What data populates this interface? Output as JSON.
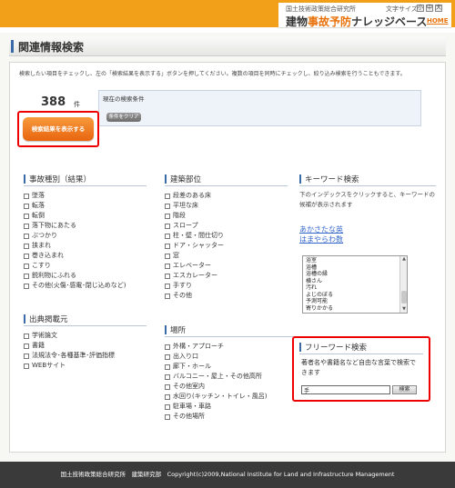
{
  "header": {
    "org_small": "国土技術政策総合研究所",
    "font_size_label": "文字サイズ",
    "font_buttons": [
      "小",
      "中",
      "大"
    ],
    "title_pre": "建物",
    "title_accent": "事故予防",
    "title_post": "ナレッジベース",
    "home_label": "HOME"
  },
  "page_title": "関連情報検索",
  "instructions": "検索したい項目をチェックし、左の「検索結果を表示する」ボタンを押してください。複数の項目を同時にチェックし、絞り込み検索を行うこともできます。",
  "result": {
    "count": "388",
    "unit": "件",
    "button_label": "検索結果を表示する"
  },
  "conditions": {
    "label": "現在の検索条件",
    "clear_label": "条件をクリア"
  },
  "accident_types": {
    "title": "事故種別（結果）",
    "items": [
      "墜落",
      "転落",
      "転倒",
      "落下物にあたる",
      "ぶつかり",
      "挟まれ",
      "巻き込まれ",
      "こすり",
      "鋭利物にふれる",
      "その他(火傷･感電･閉じ込めなど)"
    ]
  },
  "building_parts": {
    "title": "建築部位",
    "items": [
      "段差のある床",
      "平坦な床",
      "階段",
      "スロープ",
      "柱・壁・間仕切り",
      "ドア・シャッター",
      "窓",
      "エレベーター",
      "エスカレーター",
      "手すり",
      "その他"
    ]
  },
  "keyword_search": {
    "title": "キーワード検索",
    "text": "下のインデックスをクリックすると、キーワードの候補が表示されます",
    "index_line1": "あかさたな英",
    "index_line2": "はまやらわ数",
    "list": [
      "浴室",
      "浴槽",
      "浴槽の縁",
      "横さん",
      "汚れ",
      "よじのぼる",
      "予測可能",
      "寄りかかる"
    ]
  },
  "sources": {
    "title": "出典掲載元",
    "items": [
      "学術論文",
      "書籍",
      "法規法令･各種基準･評価指標",
      "WEBサイト"
    ]
  },
  "places": {
    "title": "場所",
    "items": [
      "外構・アプローチ",
      "出入り口",
      "廊下・ホール",
      "バルコニー・屋上・その他高所",
      "その他室内",
      "水回り(キッチン・トイレ・風呂)",
      "駐車場・車路",
      "その他場所"
    ]
  },
  "free_word": {
    "title": "フリーワード検索",
    "description": "著者名や書籍名など自由な言葉で検索できます",
    "input_value": "手",
    "button_label": "検索"
  },
  "footer": "国土技術政策総合研究所　建築研究部　Copyright(c)2009,National Institute for Land and Infrastructure Management"
}
